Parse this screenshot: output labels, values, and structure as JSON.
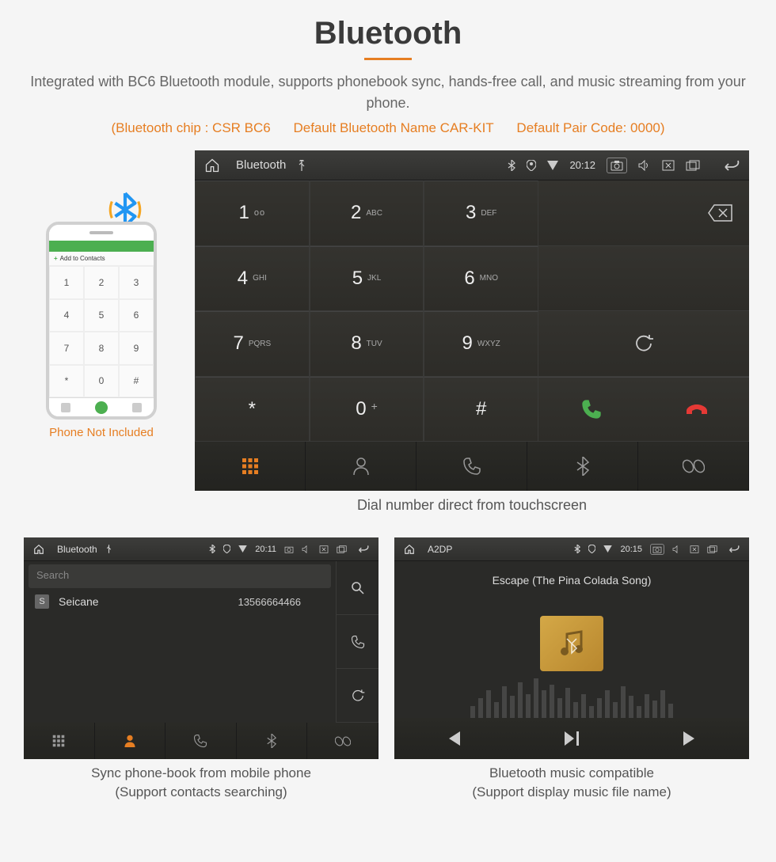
{
  "page": {
    "title": "Bluetooth",
    "subtitle": "Integrated with BC6 Bluetooth module, supports phonebook sync, hands-free call, and music streaming from your phone.",
    "info_chip": "(Bluetooth chip : CSR BC6",
    "info_name": "Default Bluetooth Name CAR-KIT",
    "info_code": "Default Pair Code: 0000)"
  },
  "phone_mock": {
    "add_label": "Add to Contacts",
    "caption": "Phone Not Included",
    "keys": [
      "1",
      "2",
      "3",
      "4",
      "5",
      "6",
      "7",
      "8",
      "9",
      "*",
      "0",
      "#"
    ]
  },
  "dialer": {
    "status": {
      "app": "Bluetooth",
      "time": "20:12"
    },
    "keys": [
      {
        "num": "1",
        "sub": "ᴏᴏ"
      },
      {
        "num": "2",
        "sub": "ABC"
      },
      {
        "num": "3",
        "sub": "DEF"
      },
      {
        "num": "4",
        "sub": "GHI"
      },
      {
        "num": "5",
        "sub": "JKL"
      },
      {
        "num": "6",
        "sub": "MNO"
      },
      {
        "num": "7",
        "sub": "PQRS"
      },
      {
        "num": "8",
        "sub": "TUV"
      },
      {
        "num": "9",
        "sub": "WXYZ"
      },
      {
        "num": "*",
        "sub": ""
      },
      {
        "num": "0",
        "sub": "+",
        "sup": true
      },
      {
        "num": "#",
        "sub": ""
      }
    ],
    "caption": "Dial number direct from touchscreen"
  },
  "phonebook": {
    "status": {
      "app": "Bluetooth",
      "time": "20:11"
    },
    "search_placeholder": "Search",
    "contact_badge": "S",
    "contact_name": "Seicane",
    "contact_number": "13566664466",
    "caption_line1": "Sync phone-book from mobile phone",
    "caption_line2": "(Support contacts searching)"
  },
  "music": {
    "status": {
      "app": "A2DP",
      "time": "20:15"
    },
    "track": "Escape (The Pina Colada Song)",
    "caption_line1": "Bluetooth music compatible",
    "caption_line2": "(Support display music file name)"
  }
}
